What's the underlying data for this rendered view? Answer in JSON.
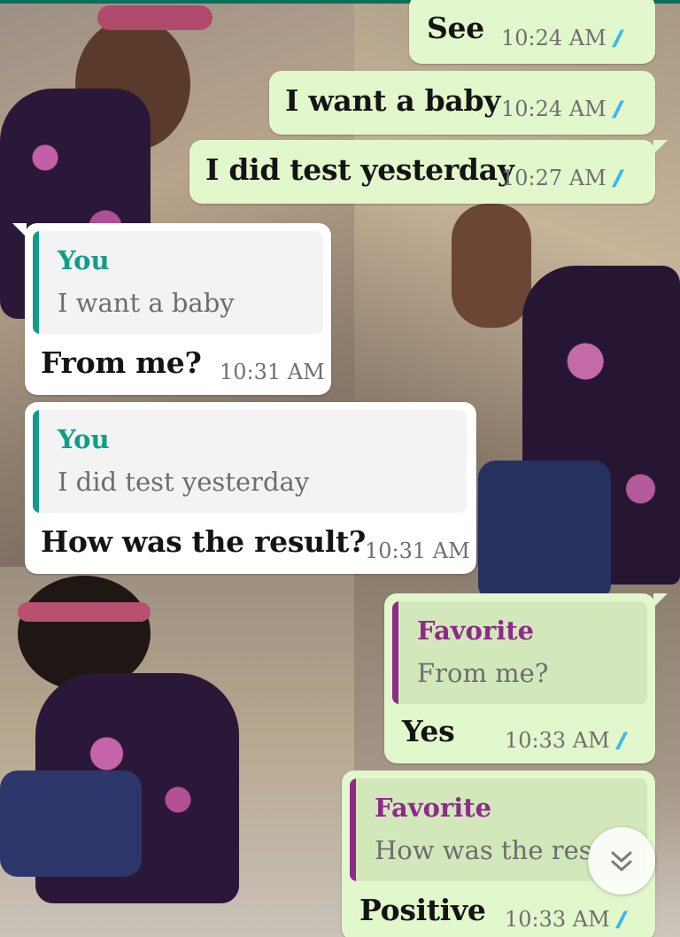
{
  "colors": {
    "outgoing_bubble": "#e2f7cb",
    "incoming_bubble": "#ffffff",
    "read_ticks": "#34b7f1",
    "quote_you": "#0f9d8a",
    "quote_favorite": "#8e2a8a"
  },
  "messages": [
    {
      "direction": "outgoing",
      "text": "See",
      "time": "10:24 AM",
      "status": "read"
    },
    {
      "direction": "outgoing",
      "text": "I want a baby",
      "time": "10:24 AM",
      "status": "read"
    },
    {
      "direction": "outgoing",
      "text": "I did test yesterday",
      "time": "10:27 AM",
      "status": "read"
    },
    {
      "direction": "incoming",
      "quote_author": "You",
      "quote_text": "I want a baby",
      "text": "From me?",
      "time": "10:31 AM"
    },
    {
      "direction": "incoming",
      "quote_author": "You",
      "quote_text": "I did test yesterday",
      "text": "How was the result?",
      "time": "10:31 AM"
    },
    {
      "direction": "outgoing",
      "quote_author": "Favorite",
      "quote_text": "From me?",
      "text": "Yes",
      "time": "10:33 AM",
      "status": "read"
    },
    {
      "direction": "outgoing",
      "quote_author": "Favorite",
      "quote_text": "How was the res",
      "text": "Positive",
      "time": "10:33 AM",
      "status": "read"
    }
  ],
  "ticks_glyph": "//",
  "scroll_button": {
    "icon": "double-chevron-down-icon"
  }
}
